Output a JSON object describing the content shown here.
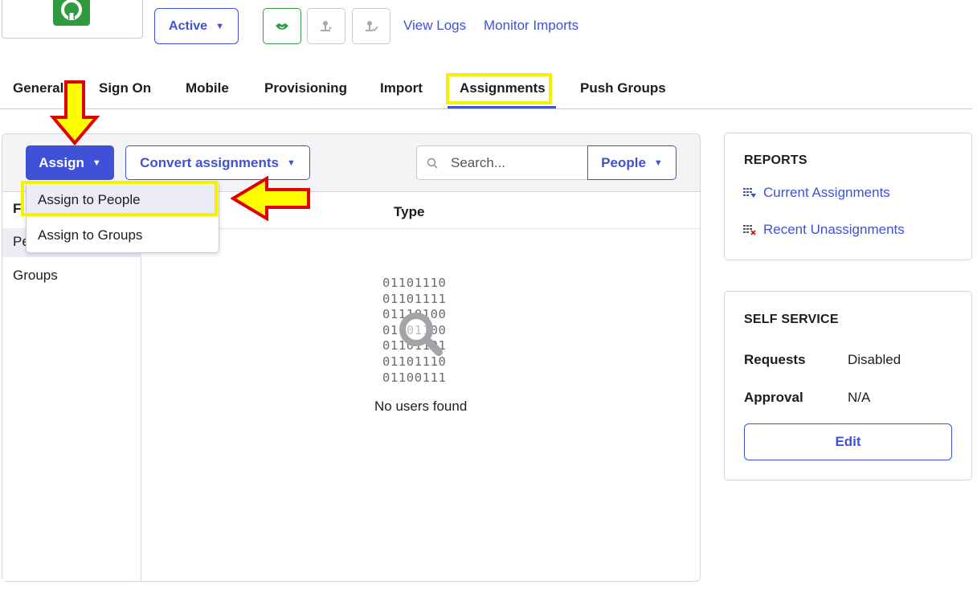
{
  "header": {
    "status_label": "Active",
    "view_logs": "View Logs",
    "monitor_imports": "Monitor Imports"
  },
  "tabs": [
    {
      "label": "General"
    },
    {
      "label": "Sign On"
    },
    {
      "label": "Mobile"
    },
    {
      "label": "Provisioning"
    },
    {
      "label": "Import"
    },
    {
      "label": "Assignments",
      "active": true
    },
    {
      "label": "Push Groups"
    }
  ],
  "toolbar": {
    "assign_label": "Assign",
    "convert_label": "Convert assignments",
    "search_placeholder": "Search...",
    "people_label": "People"
  },
  "dropdown": {
    "items": [
      {
        "label": "Assign to People",
        "highlighted": true
      },
      {
        "label": "Assign to Groups"
      }
    ]
  },
  "filters": {
    "heading_partial": "F",
    "people_partial": "Pe",
    "groups": "Groups"
  },
  "table": {
    "type_header": "Type",
    "empty_binary": [
      "01101110",
      "01101111",
      "01110100",
      "01101100",
      "01101101",
      "01101110",
      "01100111"
    ],
    "empty_message": "No users found"
  },
  "reports": {
    "title": "REPORTS",
    "current_assignments": "Current Assignments",
    "recent_unassignments": "Recent Unassignments"
  },
  "self_service": {
    "title": "SELF SERVICE",
    "requests_label": "Requests",
    "requests_value": "Disabled",
    "approval_label": "Approval",
    "approval_value": "N/A",
    "edit_label": "Edit"
  },
  "colors": {
    "accent": "#3f51d6",
    "highlight": "#f5f200",
    "arrow_fill": "#ffff00",
    "arrow_stroke": "#e10000",
    "logo_green": "#2f9a3e"
  },
  "icons": {
    "logo": "github-icon",
    "handshake": "handshake-icon",
    "push_user": "user-push-icon",
    "reactivate_user": "user-reactivate-icon",
    "search": "search-icon"
  }
}
